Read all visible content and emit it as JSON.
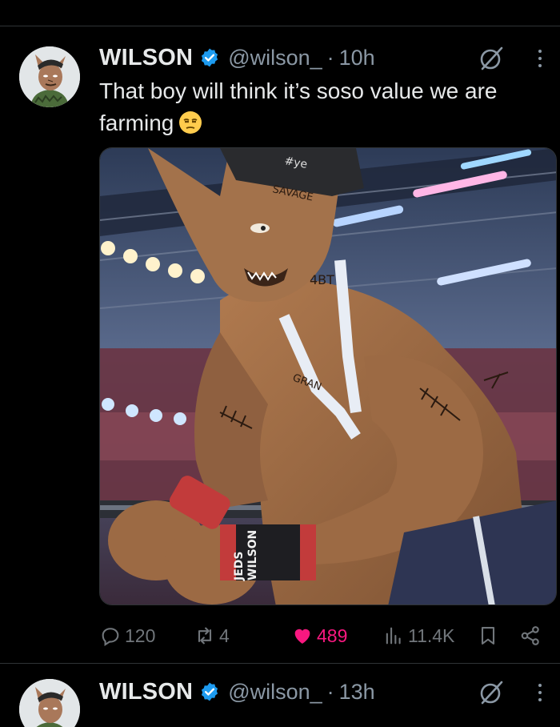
{
  "tweets": [
    {
      "author_name": "WILSON",
      "handle": "@wilson_",
      "separator": "·",
      "time": "10h",
      "text": "That boy will think it’s soso value we are farming",
      "emoji": "unamused-face",
      "media": {
        "tattoo_cap": "#ye",
        "tattoo_forehead": "SAVAGE",
        "tattoo_neck": "4BT",
        "tattoo_chest": "GRAN",
        "wrist_left": "WILSON",
        "wrist_right": "JEDS"
      },
      "actions": {
        "replies": "120",
        "reposts": "4",
        "likes": "489",
        "views": "11.4K"
      }
    },
    {
      "author_name": "WILSON",
      "handle": "@wilson_",
      "separator": "·",
      "time": "13h"
    }
  ],
  "colors": {
    "background": "#000000",
    "divider": "#2f3336",
    "verified": "#1d9bf0",
    "muted": "#71767b",
    "like": "#f91880"
  },
  "icons": [
    "verified-badge-icon",
    "grok-icon",
    "more-icon",
    "reply-icon",
    "repost-icon",
    "like-icon",
    "views-icon",
    "bookmark-icon",
    "share-icon"
  ]
}
